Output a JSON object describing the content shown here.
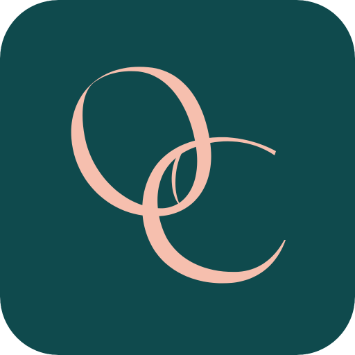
{
  "icon": {
    "semantic": "oc-monogram-logo",
    "logo_text": "OC",
    "background_color": "#0f4a4d",
    "glyph_color": "#f6bfae"
  }
}
